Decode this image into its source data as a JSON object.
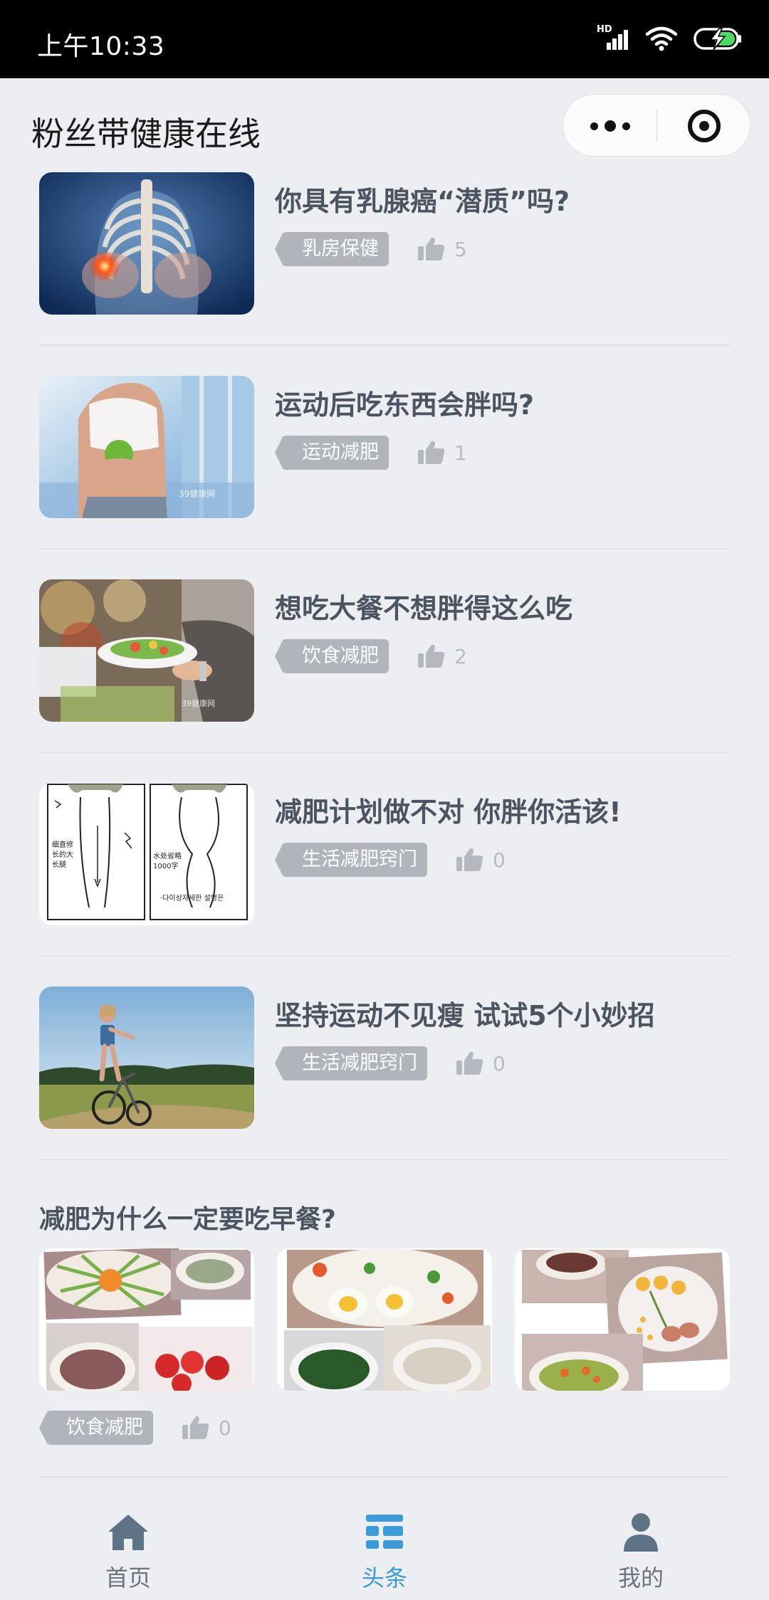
{
  "status_bar": {
    "time": "上午10:33",
    "network_badge": "HD"
  },
  "header": {
    "title": "粉丝带健康在线"
  },
  "articles": [
    {
      "title": "你具有乳腺癌“潜质”吗?",
      "tag": "乳房保健",
      "likes": "5",
      "image": "breast-anatomy"
    },
    {
      "title": "运动后吃东西会胖吗?",
      "tag": "运动减肥",
      "likes": "1",
      "image": "woman-with-apple"
    },
    {
      "title": "想吃大餐不想胖得这么吃",
      "tag": "饮食减肥",
      "likes": "2",
      "image": "buffet-plate"
    },
    {
      "title": "减肥计划做不对 你胖你活该!",
      "tag": "生活减肥窍门",
      "likes": "0",
      "image": "legs-illustration"
    },
    {
      "title": "坚持运动不见瘦 试试5个小妙招",
      "tag": "生活减肥窍门",
      "likes": "0",
      "image": "woman-cycling"
    }
  ],
  "gallery_article": {
    "title": "减肥为什么一定要吃早餐?",
    "tag": "饮食减肥",
    "likes": "0",
    "images": [
      "breakfast-salad",
      "breakfast-eggs",
      "breakfast-porridge"
    ]
  },
  "tabbar": {
    "items": [
      {
        "label": "首页",
        "icon": "home-icon"
      },
      {
        "label": "头条",
        "icon": "headlines-icon"
      },
      {
        "label": "我的",
        "icon": "user-icon"
      }
    ],
    "active_index": 1,
    "active_color": "#3d9ad8",
    "inactive_color": "#6b737c"
  },
  "colors": {
    "page_bg": "#eceef1",
    "tag_bg": "#b0b5bb",
    "title_text": "#4b5562"
  }
}
